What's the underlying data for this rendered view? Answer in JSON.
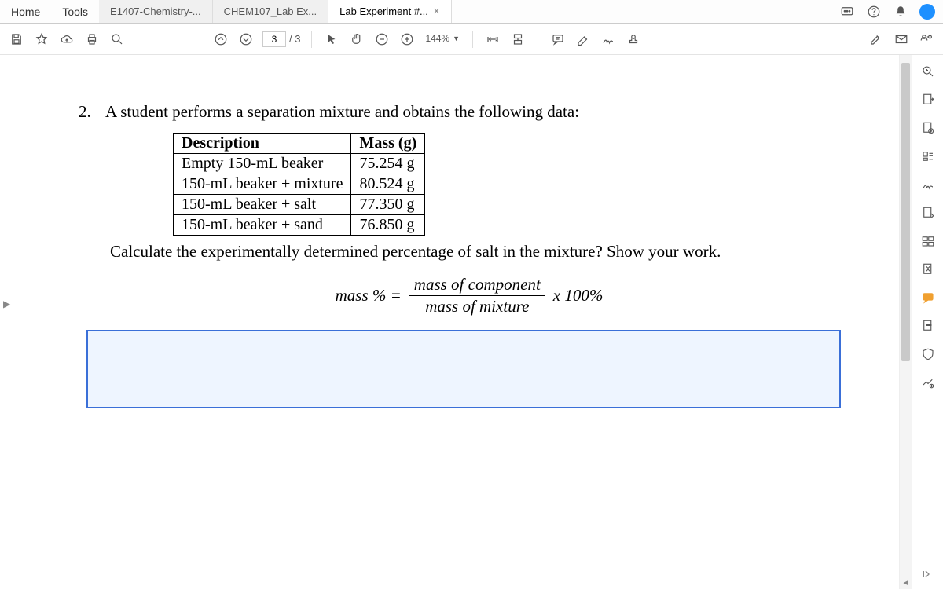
{
  "menu": {
    "home": "Home",
    "tools": "Tools"
  },
  "tabs": [
    {
      "label": "E1407-Chemistry-...",
      "active": false,
      "closable": false
    },
    {
      "label": "CHEM107_Lab Ex...",
      "active": false,
      "closable": false
    },
    {
      "label": "Lab Experiment #...",
      "active": true,
      "closable": true
    }
  ],
  "toolbar": {
    "page_current": "3",
    "page_sep": "/ 3",
    "zoom": "144%"
  },
  "document": {
    "question_number": "2.",
    "question_text": "A student performs a separation mixture and obtains the following data:",
    "table": {
      "headers": [
        "Description",
        "Mass (g)"
      ],
      "rows": [
        [
          "Empty 150-mL beaker",
          "75.254 g"
        ],
        [
          "150-mL beaker + mixture",
          "80.524 g"
        ],
        [
          "150-mL beaker + salt",
          "77.350 g"
        ],
        [
          "150-mL beaker + sand",
          "76.850 g"
        ]
      ]
    },
    "after_table": "Calculate the experimentally determined percentage of salt in the mixture? Show your work.",
    "formula": {
      "lhs": "mass % =",
      "numerator": "mass of component",
      "denominator": "mass of mixture",
      "rhs": "x 100%"
    }
  }
}
